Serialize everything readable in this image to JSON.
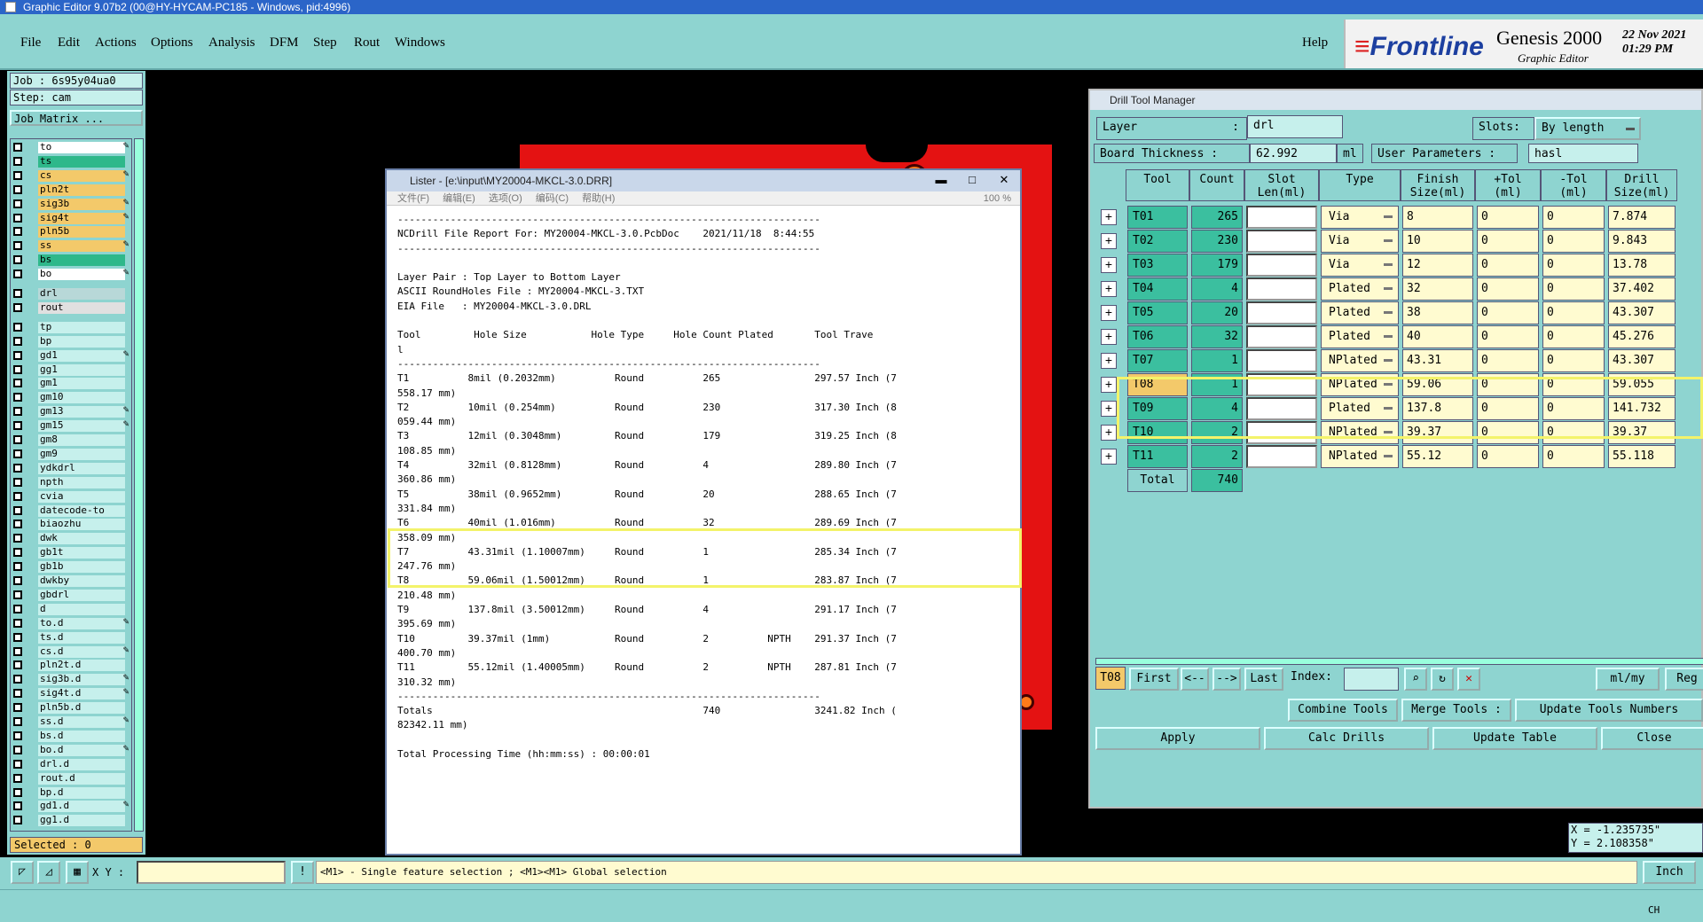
{
  "window_title": "Graphic Editor 9.07b2 (00@HY-HYCAM-PC185 - Windows, pid:4996)",
  "menu": [
    "File",
    "Edit",
    "Actions",
    "Options",
    "Analysis",
    "DFM",
    "Step",
    "Rout",
    "Windows"
  ],
  "help": "Help",
  "brand": {
    "logo": "Frontline",
    "product": "Genesis 2000",
    "subtitle": "Graphic Editor",
    "date": "22 Nov 2021",
    "time": "01:29 PM"
  },
  "job": "Job : 6s95y04ua0",
  "step": "Step: cam",
  "job_matrix": "Job Matrix ...",
  "layers": [
    {
      "name": "to",
      "color": "#ffffff",
      "pen": true
    },
    {
      "name": "ts",
      "color": "#2eb88a",
      "pen": false
    },
    {
      "name": "cs",
      "color": "#f3c96a",
      "pen": true
    },
    {
      "name": "pln2t",
      "color": "#f3c96a",
      "pen": false
    },
    {
      "name": "sig3b",
      "color": "#f3c96a",
      "pen": true
    },
    {
      "name": "sig4t",
      "color": "#f3c96a",
      "pen": true
    },
    {
      "name": "pln5b",
      "color": "#f3c96a",
      "pen": false
    },
    {
      "name": "ss",
      "color": "#f3c96a",
      "pen": true
    },
    {
      "name": "bs",
      "color": "#2eb88a",
      "pen": false
    },
    {
      "name": "bo",
      "color": "#ffffff",
      "pen": true
    },
    {
      "name": "drl",
      "color": "#b8d8d8",
      "pen": false
    },
    {
      "name": "rout",
      "color": "#e0e0e0",
      "pen": false
    },
    {
      "name": "tp",
      "color": "#c6f0ec",
      "pen": false
    },
    {
      "name": "bp",
      "color": "#c6f0ec",
      "pen": false
    },
    {
      "name": "gd1",
      "color": "#c6f0ec",
      "pen": true
    },
    {
      "name": "gg1",
      "color": "#c6f0ec",
      "pen": false
    },
    {
      "name": "gm1",
      "color": "#c6f0ec",
      "pen": false
    },
    {
      "name": "gm10",
      "color": "#c6f0ec",
      "pen": false
    },
    {
      "name": "gm13",
      "color": "#c6f0ec",
      "pen": true
    },
    {
      "name": "gm15",
      "color": "#c6f0ec",
      "pen": true
    },
    {
      "name": "gm8",
      "color": "#c6f0ec",
      "pen": false
    },
    {
      "name": "gm9",
      "color": "#c6f0ec",
      "pen": false
    },
    {
      "name": "ydkdrl",
      "color": "#c6f0ec",
      "pen": false
    },
    {
      "name": "npth",
      "color": "#c6f0ec",
      "pen": false
    },
    {
      "name": "cvia",
      "color": "#c6f0ec",
      "pen": false
    },
    {
      "name": "datecode-to",
      "color": "#c6f0ec",
      "pen": false
    },
    {
      "name": "biaozhu",
      "color": "#c6f0ec",
      "pen": false
    },
    {
      "name": "dwk",
      "color": "#c6f0ec",
      "pen": false
    },
    {
      "name": "gb1t",
      "color": "#c6f0ec",
      "pen": false
    },
    {
      "name": "gb1b",
      "color": "#c6f0ec",
      "pen": false
    },
    {
      "name": "dwkby",
      "color": "#c6f0ec",
      "pen": false
    },
    {
      "name": "gbdrl",
      "color": "#c6f0ec",
      "pen": false
    },
    {
      "name": "d",
      "color": "#c6f0ec",
      "pen": false
    },
    {
      "name": "to.d",
      "color": "#c6f0ec",
      "pen": true
    },
    {
      "name": "ts.d",
      "color": "#c6f0ec",
      "pen": false
    },
    {
      "name": "cs.d",
      "color": "#c6f0ec",
      "pen": true
    },
    {
      "name": "pln2t.d",
      "color": "#c6f0ec",
      "pen": false
    },
    {
      "name": "sig3b.d",
      "color": "#c6f0ec",
      "pen": true
    },
    {
      "name": "sig4t.d",
      "color": "#c6f0ec",
      "pen": true
    },
    {
      "name": "pln5b.d",
      "color": "#c6f0ec",
      "pen": false
    },
    {
      "name": "ss.d",
      "color": "#c6f0ec",
      "pen": true
    },
    {
      "name": "bs.d",
      "color": "#c6f0ec",
      "pen": false
    },
    {
      "name": "bo.d",
      "color": "#c6f0ec",
      "pen": true
    },
    {
      "name": "drl.d",
      "color": "#c6f0ec",
      "pen": false
    },
    {
      "name": "rout.d",
      "color": "#c6f0ec",
      "pen": false
    },
    {
      "name": "bp.d",
      "color": "#c6f0ec",
      "pen": false
    },
    {
      "name": "gd1.d",
      "color": "#c6f0ec",
      "pen": true
    },
    {
      "name": "gg1.d",
      "color": "#c6f0ec",
      "pen": false
    }
  ],
  "selected": "Selected : 0",
  "lister": {
    "title": "Lister - [e:\\input\\MY20004-MKCL-3.0.DRR]",
    "menu": [
      "文件(F)",
      "编辑(E)",
      "选项(O)",
      "编码(C)",
      "帮助(H)"
    ],
    "zoom": "100 %",
    "lines": [
      "------------------------------------------------------------------------",
      "NCDrill File Report For: MY20004-MKCL-3.0.PcbDoc    2021/11/18  8:44:55",
      "------------------------------------------------------------------------",
      "",
      "Layer Pair : Top Layer to Bottom Layer",
      "ASCII RoundHoles File : MY20004-MKCL-3.TXT",
      "EIA File   : MY20004-MKCL-3.0.DRL",
      "",
      "Tool         Hole Size           Hole Type     Hole Count Plated       Tool Trave",
      "l",
      "------------------------------------------------------------------------",
      "T1          8mil (0.2032mm)          Round          265                297.57 Inch (7",
      "558.17 mm)",
      "T2          10mil (0.254mm)          Round          230                317.30 Inch (8",
      "059.44 mm)",
      "T3          12mil (0.3048mm)         Round          179                319.25 Inch (8",
      "108.85 mm)",
      "T4          32mil (0.8128mm)         Round          4                  289.80 Inch (7",
      "360.86 mm)",
      "T5          38mil (0.9652mm)         Round          20                 288.65 Inch (7",
      "331.84 mm)",
      "T6          40mil (1.016mm)          Round          32                 289.69 Inch (7",
      "358.09 mm)",
      "T7          43.31mil (1.10007mm)     Round          1                  285.34 Inch (7",
      "247.76 mm)",
      "T8          59.06mil (1.50012mm)     Round          1                  283.87 Inch (7",
      "210.48 mm)",
      "T9          137.8mil (3.50012mm)     Round          4                  291.17 Inch (7",
      "395.69 mm)",
      "T10         39.37mil (1mm)           Round          2          NPTH    291.37 Inch (7",
      "400.70 mm)",
      "T11         55.12mil (1.40005mm)     Round          2          NPTH    287.81 Inch (7",
      "310.32 mm)",
      "------------------------------------------------------------------------",
      "Totals                                              740                3241.82 Inch (",
      "82342.11 mm)",
      "",
      "Total Processing Time (hh:mm:ss) : 00:00:01"
    ]
  },
  "dtm": {
    "title": "Drill Tool Manager",
    "layer_label": "Layer",
    "layer_value": "drl",
    "slots_label": "Slots:",
    "slots_value": "By length",
    "board_thickness_label": "Board Thickness :",
    "board_thickness_value": "62.992",
    "board_thickness_unit": "ml",
    "user_params_label": "User Parameters :",
    "user_params_value": "hasl",
    "headers": [
      "Tool",
      "Count",
      "Slot\nLen(ml)",
      "Type",
      "Finish\nSize(ml)",
      "+Tol\n(ml)",
      "-Tol\n(ml)",
      "Drill\nSize(ml)"
    ],
    "rows": [
      {
        "tool": "T01",
        "count": "265",
        "type": "Via",
        "finish": "8",
        "ptol": "0",
        "ntol": "0",
        "drill": "7.874"
      },
      {
        "tool": "T02",
        "count": "230",
        "type": "Via",
        "finish": "10",
        "ptol": "0",
        "ntol": "0",
        "drill": "9.843"
      },
      {
        "tool": "T03",
        "count": "179",
        "type": "Via",
        "finish": "12",
        "ptol": "0",
        "ntol": "0",
        "drill": "13.78"
      },
      {
        "tool": "T04",
        "count": "4",
        "type": "Plated",
        "finish": "32",
        "ptol": "0",
        "ntol": "0",
        "drill": "37.402"
      },
      {
        "tool": "T05",
        "count": "20",
        "type": "Plated",
        "finish": "38",
        "ptol": "0",
        "ntol": "0",
        "drill": "43.307"
      },
      {
        "tool": "T06",
        "count": "32",
        "type": "Plated",
        "finish": "40",
        "ptol": "0",
        "ntol": "0",
        "drill": "45.276"
      },
      {
        "tool": "T07",
        "count": "1",
        "type": "NPlated",
        "finish": "43.31",
        "ptol": "0",
        "ntol": "0",
        "drill": "43.307"
      },
      {
        "tool": "T08",
        "count": "1",
        "type": "NPlated",
        "finish": "59.06",
        "ptol": "0",
        "ntol": "0",
        "drill": "59.055"
      },
      {
        "tool": "T09",
        "count": "4",
        "type": "Plated",
        "finish": "137.8",
        "ptol": "0",
        "ntol": "0",
        "drill": "141.732"
      },
      {
        "tool": "T10",
        "count": "2",
        "type": "NPlated",
        "finish": "39.37",
        "ptol": "0",
        "ntol": "0",
        "drill": "39.37"
      },
      {
        "tool": "T11",
        "count": "2",
        "type": "NPlated",
        "finish": "55.12",
        "ptol": "0",
        "ntol": "0",
        "drill": "55.118"
      }
    ],
    "total_label": "Total",
    "total_count": "740",
    "current_tool": "T08",
    "nav": {
      "first": "First",
      "prev": "<--",
      "next": "-->",
      "last": "Last",
      "index": "Index:",
      "units": "ml/my",
      "reg": "Reg"
    },
    "actions": {
      "combine": "Combine Tools",
      "merge": "Merge Tools :",
      "update_numbers": "Update Tools Numbers",
      "apply": "Apply",
      "calc": "Calc Drills",
      "update_table": "Update Table",
      "close": "Close"
    }
  },
  "coords": {
    "x": "X = -1.235735\"",
    "y": "Y = 2.108358\""
  },
  "bottom": {
    "xy_label": "X Y :",
    "hint": "<M1> - Single feature selection ; <M1><M1> Global selection",
    "units": "Inch"
  },
  "tray": {
    "lang": "CH"
  }
}
